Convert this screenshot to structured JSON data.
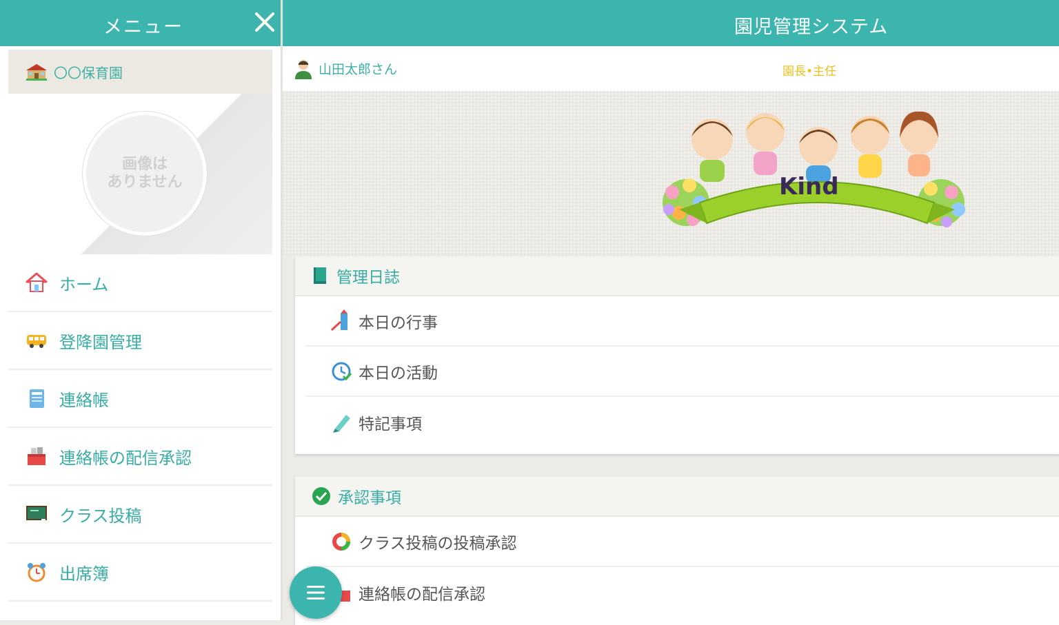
{
  "sidebar": {
    "title": "メニュー",
    "school_name": "〇〇保育園",
    "no_image_line1": "画像は",
    "no_image_line2": "ありません",
    "items": [
      {
        "label": "ホーム",
        "icon": "house-icon"
      },
      {
        "label": "登降園管理",
        "icon": "bus-icon"
      },
      {
        "label": "連絡帳",
        "icon": "notebook-icon"
      },
      {
        "label": "連絡帳の配信承認",
        "icon": "mailbox-icon"
      },
      {
        "label": "クラス投稿",
        "icon": "blackboard-icon"
      },
      {
        "label": "出席簿",
        "icon": "alarm-clock-icon"
      }
    ]
  },
  "header": {
    "title": "園児管理システム"
  },
  "user": {
    "name": "山田太郎さん",
    "role": "園長•主任"
  },
  "banner": {
    "logo_text": "Kind"
  },
  "cards": [
    {
      "title": "管理日誌",
      "items": [
        {
          "label": "本日の行事"
        },
        {
          "label": "本日の活動"
        },
        {
          "label": "特記事項"
        }
      ]
    },
    {
      "title": "承認事項",
      "items": [
        {
          "label": "クラス投稿の投稿承認"
        },
        {
          "label": "連絡帳の配信承認"
        }
      ]
    }
  ],
  "colors": {
    "accent": "#3bb5ad",
    "role": "#e5c21e"
  }
}
